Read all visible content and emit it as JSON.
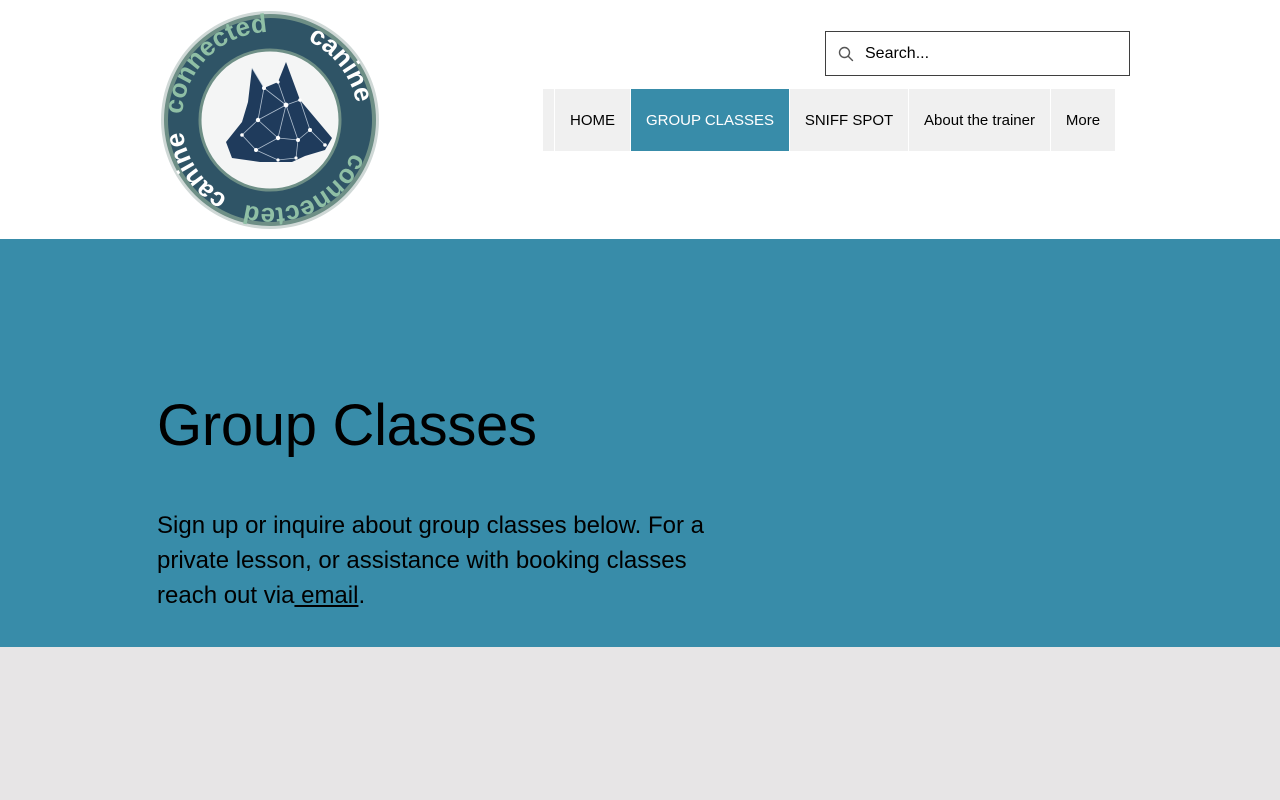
{
  "logo": {
    "text_top": "connected",
    "text_right": "canine",
    "text_bottom": "connected",
    "text_left": "canine"
  },
  "search": {
    "placeholder": "Search..."
  },
  "nav": {
    "items": [
      {
        "label": "HOME"
      },
      {
        "label": "GROUP CLASSES",
        "active": true
      },
      {
        "label": "SNIFF SPOT"
      },
      {
        "label": "About the trainer"
      },
      {
        "label": "More"
      }
    ]
  },
  "hero": {
    "title": "Group Classes",
    "intro_before_link": "Sign up or inquire about group classes below. For a private lesson, or assistance with booking classes reach out via",
    "email_link": " email",
    "intro_after_link": "."
  },
  "colors": {
    "accent": "#388ca9",
    "nav_bg": "#f0f0f0",
    "lower_bg": "#e7e5e6",
    "logo_ring": "#2f5466",
    "logo_text": "#8fbfa5"
  },
  "icons": {
    "search": "search-icon",
    "logo": "dog-head-constellation-icon"
  }
}
